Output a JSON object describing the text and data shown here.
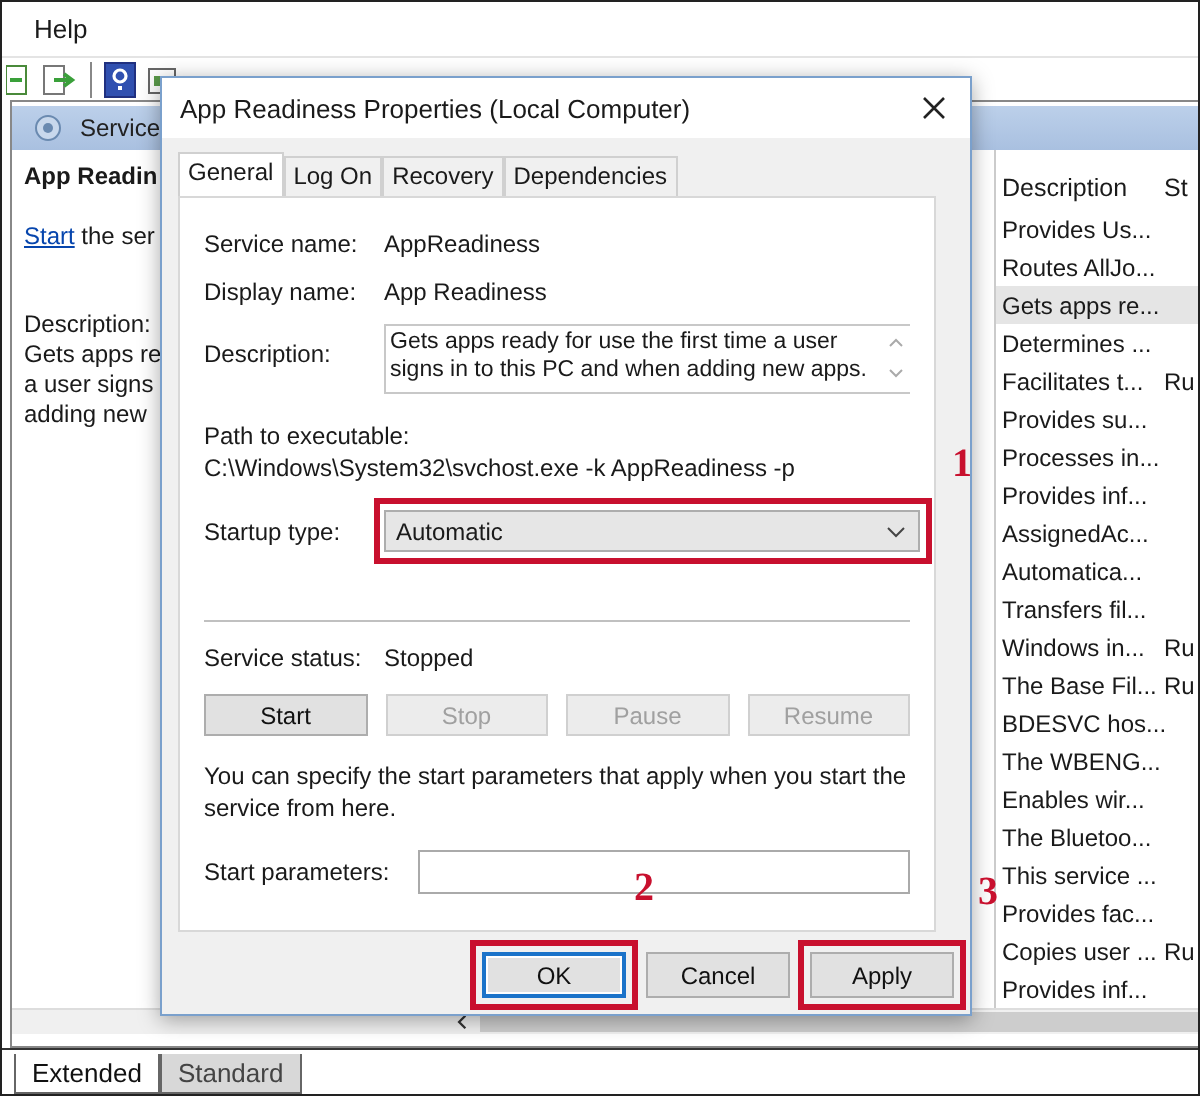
{
  "menu_bar": {
    "items": [
      "Help"
    ]
  },
  "left_pane": {
    "header": "Service",
    "title": "App Readin",
    "link": "Start",
    "link_rest": " the ser",
    "description_label": "Description:",
    "description_lines": [
      "Gets apps re",
      "a user signs",
      "adding new"
    ]
  },
  "services_list": {
    "columns": [
      "Description",
      "St"
    ],
    "rows": [
      {
        "description": "Provides Us...",
        "status": "",
        "selected": false
      },
      {
        "description": "Routes AllJo...",
        "status": "",
        "selected": false
      },
      {
        "description": "Gets apps re...",
        "status": "",
        "selected": true
      },
      {
        "description": "Determines ...",
        "status": "",
        "selected": false
      },
      {
        "description": "Facilitates t...",
        "status": "Ru",
        "selected": false
      },
      {
        "description": "Provides su...",
        "status": "",
        "selected": false
      },
      {
        "description": "Processes in...",
        "status": "",
        "selected": false
      },
      {
        "description": "Provides inf...",
        "status": "",
        "selected": false
      },
      {
        "description": "AssignedAc...",
        "status": "",
        "selected": false
      },
      {
        "description": "Automatica...",
        "status": "",
        "selected": false
      },
      {
        "description": "Transfers fil...",
        "status": "",
        "selected": false
      },
      {
        "description": "Windows in...",
        "status": "Ru",
        "selected": false
      },
      {
        "description": "The Base Fil...",
        "status": "Ru",
        "selected": false
      },
      {
        "description": "BDESVC hos...",
        "status": "",
        "selected": false
      },
      {
        "description": "The WBENG...",
        "status": "",
        "selected": false
      },
      {
        "description": "Enables wir...",
        "status": "",
        "selected": false
      },
      {
        "description": "The Bluetoo...",
        "status": "",
        "selected": false
      },
      {
        "description": "This service ...",
        "status": "",
        "selected": false
      },
      {
        "description": "Provides fac...",
        "status": "",
        "selected": false
      },
      {
        "description": "Copies user ...",
        "status": "Ru",
        "selected": false
      },
      {
        "description": "Provides inf...",
        "status": "",
        "selected": false
      }
    ]
  },
  "bottom_tabs": [
    {
      "label": "Extended",
      "selected": true
    },
    {
      "label": "Standard",
      "selected": false
    }
  ],
  "dialog": {
    "title": "App Readiness Properties (Local Computer)",
    "tabs": [
      {
        "label": "General",
        "selected": true
      },
      {
        "label": "Log On",
        "selected": false
      },
      {
        "label": "Recovery",
        "selected": false
      },
      {
        "label": "Dependencies",
        "selected": false
      }
    ],
    "service_name_label": "Service name:",
    "service_name": "AppReadiness",
    "display_name_label": "Display name:",
    "display_name": "App Readiness",
    "description_label": "Description:",
    "description": "Gets apps ready for use the first time a user signs in to this PC and when adding new apps.",
    "path_label": "Path to executable:",
    "path": "C:\\Windows\\System32\\svchost.exe -k AppReadiness -p",
    "startup_type_label": "Startup type:",
    "startup_type": "Automatic",
    "startup_type_annotation": "1",
    "service_status_label": "Service status:",
    "service_status": "Stopped",
    "service_buttons": [
      {
        "label": "Start",
        "disabled": false
      },
      {
        "label": "Stop",
        "disabled": true
      },
      {
        "label": "Pause",
        "disabled": true
      },
      {
        "label": "Resume",
        "disabled": true
      }
    ],
    "hint": "You can specify the start parameters that apply when you start the service from here.",
    "start_parameters_label": "Start parameters:",
    "buttons": [
      {
        "label": "OK",
        "default": true,
        "annotation": "2"
      },
      {
        "label": "Cancel",
        "default": false
      },
      {
        "label": "Apply",
        "default": false,
        "annotation": "3"
      }
    ]
  }
}
